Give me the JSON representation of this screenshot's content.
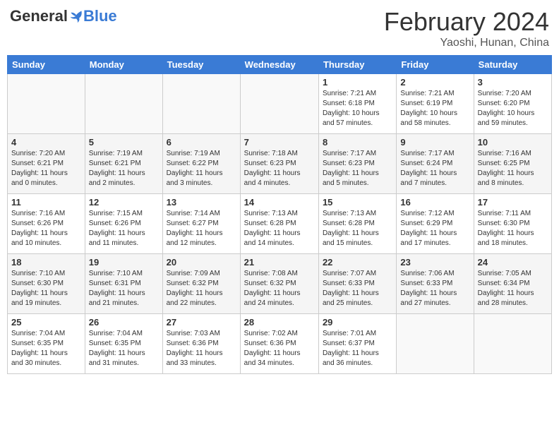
{
  "logo": {
    "general": "General",
    "blue": "Blue"
  },
  "header": {
    "month": "February 2024",
    "location": "Yaoshi, Hunan, China"
  },
  "weekdays": [
    "Sunday",
    "Monday",
    "Tuesday",
    "Wednesday",
    "Thursday",
    "Friday",
    "Saturday"
  ],
  "weeks": [
    [
      {
        "day": "",
        "info": ""
      },
      {
        "day": "",
        "info": ""
      },
      {
        "day": "",
        "info": ""
      },
      {
        "day": "",
        "info": ""
      },
      {
        "day": "1",
        "info": "Sunrise: 7:21 AM\nSunset: 6:18 PM\nDaylight: 10 hours\nand 57 minutes."
      },
      {
        "day": "2",
        "info": "Sunrise: 7:21 AM\nSunset: 6:19 PM\nDaylight: 10 hours\nand 58 minutes."
      },
      {
        "day": "3",
        "info": "Sunrise: 7:20 AM\nSunset: 6:20 PM\nDaylight: 10 hours\nand 59 minutes."
      }
    ],
    [
      {
        "day": "4",
        "info": "Sunrise: 7:20 AM\nSunset: 6:21 PM\nDaylight: 11 hours\nand 0 minutes."
      },
      {
        "day": "5",
        "info": "Sunrise: 7:19 AM\nSunset: 6:21 PM\nDaylight: 11 hours\nand 2 minutes."
      },
      {
        "day": "6",
        "info": "Sunrise: 7:19 AM\nSunset: 6:22 PM\nDaylight: 11 hours\nand 3 minutes."
      },
      {
        "day": "7",
        "info": "Sunrise: 7:18 AM\nSunset: 6:23 PM\nDaylight: 11 hours\nand 4 minutes."
      },
      {
        "day": "8",
        "info": "Sunrise: 7:17 AM\nSunset: 6:23 PM\nDaylight: 11 hours\nand 5 minutes."
      },
      {
        "day": "9",
        "info": "Sunrise: 7:17 AM\nSunset: 6:24 PM\nDaylight: 11 hours\nand 7 minutes."
      },
      {
        "day": "10",
        "info": "Sunrise: 7:16 AM\nSunset: 6:25 PM\nDaylight: 11 hours\nand 8 minutes."
      }
    ],
    [
      {
        "day": "11",
        "info": "Sunrise: 7:16 AM\nSunset: 6:26 PM\nDaylight: 11 hours\nand 10 minutes."
      },
      {
        "day": "12",
        "info": "Sunrise: 7:15 AM\nSunset: 6:26 PM\nDaylight: 11 hours\nand 11 minutes."
      },
      {
        "day": "13",
        "info": "Sunrise: 7:14 AM\nSunset: 6:27 PM\nDaylight: 11 hours\nand 12 minutes."
      },
      {
        "day": "14",
        "info": "Sunrise: 7:13 AM\nSunset: 6:28 PM\nDaylight: 11 hours\nand 14 minutes."
      },
      {
        "day": "15",
        "info": "Sunrise: 7:13 AM\nSunset: 6:28 PM\nDaylight: 11 hours\nand 15 minutes."
      },
      {
        "day": "16",
        "info": "Sunrise: 7:12 AM\nSunset: 6:29 PM\nDaylight: 11 hours\nand 17 minutes."
      },
      {
        "day": "17",
        "info": "Sunrise: 7:11 AM\nSunset: 6:30 PM\nDaylight: 11 hours\nand 18 minutes."
      }
    ],
    [
      {
        "day": "18",
        "info": "Sunrise: 7:10 AM\nSunset: 6:30 PM\nDaylight: 11 hours\nand 19 minutes."
      },
      {
        "day": "19",
        "info": "Sunrise: 7:10 AM\nSunset: 6:31 PM\nDaylight: 11 hours\nand 21 minutes."
      },
      {
        "day": "20",
        "info": "Sunrise: 7:09 AM\nSunset: 6:32 PM\nDaylight: 11 hours\nand 22 minutes."
      },
      {
        "day": "21",
        "info": "Sunrise: 7:08 AM\nSunset: 6:32 PM\nDaylight: 11 hours\nand 24 minutes."
      },
      {
        "day": "22",
        "info": "Sunrise: 7:07 AM\nSunset: 6:33 PM\nDaylight: 11 hours\nand 25 minutes."
      },
      {
        "day": "23",
        "info": "Sunrise: 7:06 AM\nSunset: 6:33 PM\nDaylight: 11 hours\nand 27 minutes."
      },
      {
        "day": "24",
        "info": "Sunrise: 7:05 AM\nSunset: 6:34 PM\nDaylight: 11 hours\nand 28 minutes."
      }
    ],
    [
      {
        "day": "25",
        "info": "Sunrise: 7:04 AM\nSunset: 6:35 PM\nDaylight: 11 hours\nand 30 minutes."
      },
      {
        "day": "26",
        "info": "Sunrise: 7:04 AM\nSunset: 6:35 PM\nDaylight: 11 hours\nand 31 minutes."
      },
      {
        "day": "27",
        "info": "Sunrise: 7:03 AM\nSunset: 6:36 PM\nDaylight: 11 hours\nand 33 minutes."
      },
      {
        "day": "28",
        "info": "Sunrise: 7:02 AM\nSunset: 6:36 PM\nDaylight: 11 hours\nand 34 minutes."
      },
      {
        "day": "29",
        "info": "Sunrise: 7:01 AM\nSunset: 6:37 PM\nDaylight: 11 hours\nand 36 minutes."
      },
      {
        "day": "",
        "info": ""
      },
      {
        "day": "",
        "info": ""
      }
    ]
  ]
}
